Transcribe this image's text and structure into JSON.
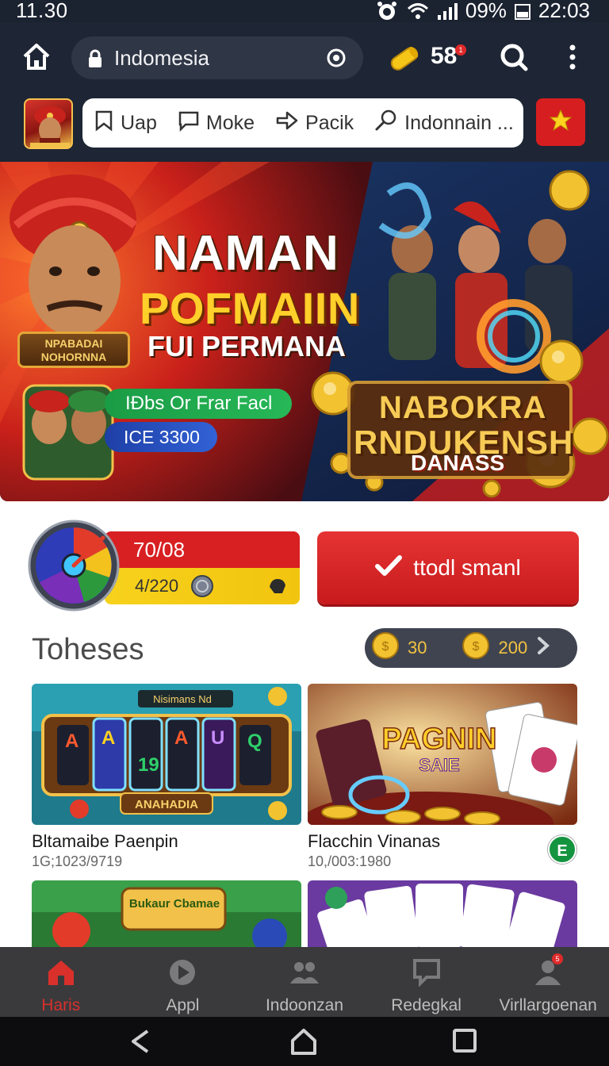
{
  "status_bar": {
    "time_left": "11.30",
    "battery": "09%",
    "clock": "22:03"
  },
  "browser": {
    "url": "Indomesia",
    "coin_count": "58",
    "coin_badge": "1"
  },
  "categories": [
    {
      "label": "Uap",
      "icon": "bookmark-icon"
    },
    {
      "label": "Moke",
      "icon": "chat-icon"
    },
    {
      "label": "Pacik",
      "icon": "share-icon"
    },
    {
      "label": "Indonnain ...",
      "icon": "search-icon"
    }
  ],
  "hero": {
    "title_line1": "NAMAN",
    "title_line2": "POFMAIIN",
    "title_line3": "FUI PERMANA",
    "plaque": "NPABADAI NOHORNNA",
    "promo_green": "IÐbs Or Frar Facl",
    "promo_blue": "ICE 3300",
    "brand_line1": "NABOKRA",
    "brand_line2": "RNDUKENSH",
    "brand_line3": "DANASS"
  },
  "progress": {
    "top_value": "70/08",
    "bottom_value": "4/220",
    "fill_fraction": 0.5
  },
  "claim_button": {
    "label": "ttodl smanl"
  },
  "section": {
    "title": "Toheses",
    "balance_a": "30",
    "balance_b": "200"
  },
  "games": [
    {
      "title": "Bltamaibe Paenpin",
      "meta": "1G;1023/9719",
      "thumb_top": "Nisimans Nd",
      "thumb_bottom": "ANAHADIA"
    },
    {
      "title": "Flacchin Vinanas",
      "meta": "10,/003:1980",
      "thumb_label_1": "PAGNIN",
      "thumb_label_2": "SAIE",
      "badge": "E"
    },
    {
      "thumb_label": "Bukaur Cbamae"
    },
    {
      "thumb_label": ""
    }
  ],
  "bottom_nav": [
    {
      "label": "Haris",
      "icon": "home-icon",
      "active": true
    },
    {
      "label": "Appl",
      "icon": "play-icon",
      "active": false
    },
    {
      "label": "Indoonzan",
      "icon": "users-icon",
      "active": false
    },
    {
      "label": "Redegkal",
      "icon": "chat-icon",
      "active": false
    },
    {
      "label": "Virllargoenan",
      "icon": "profile-icon",
      "active": false,
      "badge": "5"
    }
  ],
  "colors": {
    "brand_red": "#d81f22",
    "accent_gold": "#f2c241",
    "dark_bg": "#1e2534",
    "nav_bg": "#3a3a3c"
  }
}
